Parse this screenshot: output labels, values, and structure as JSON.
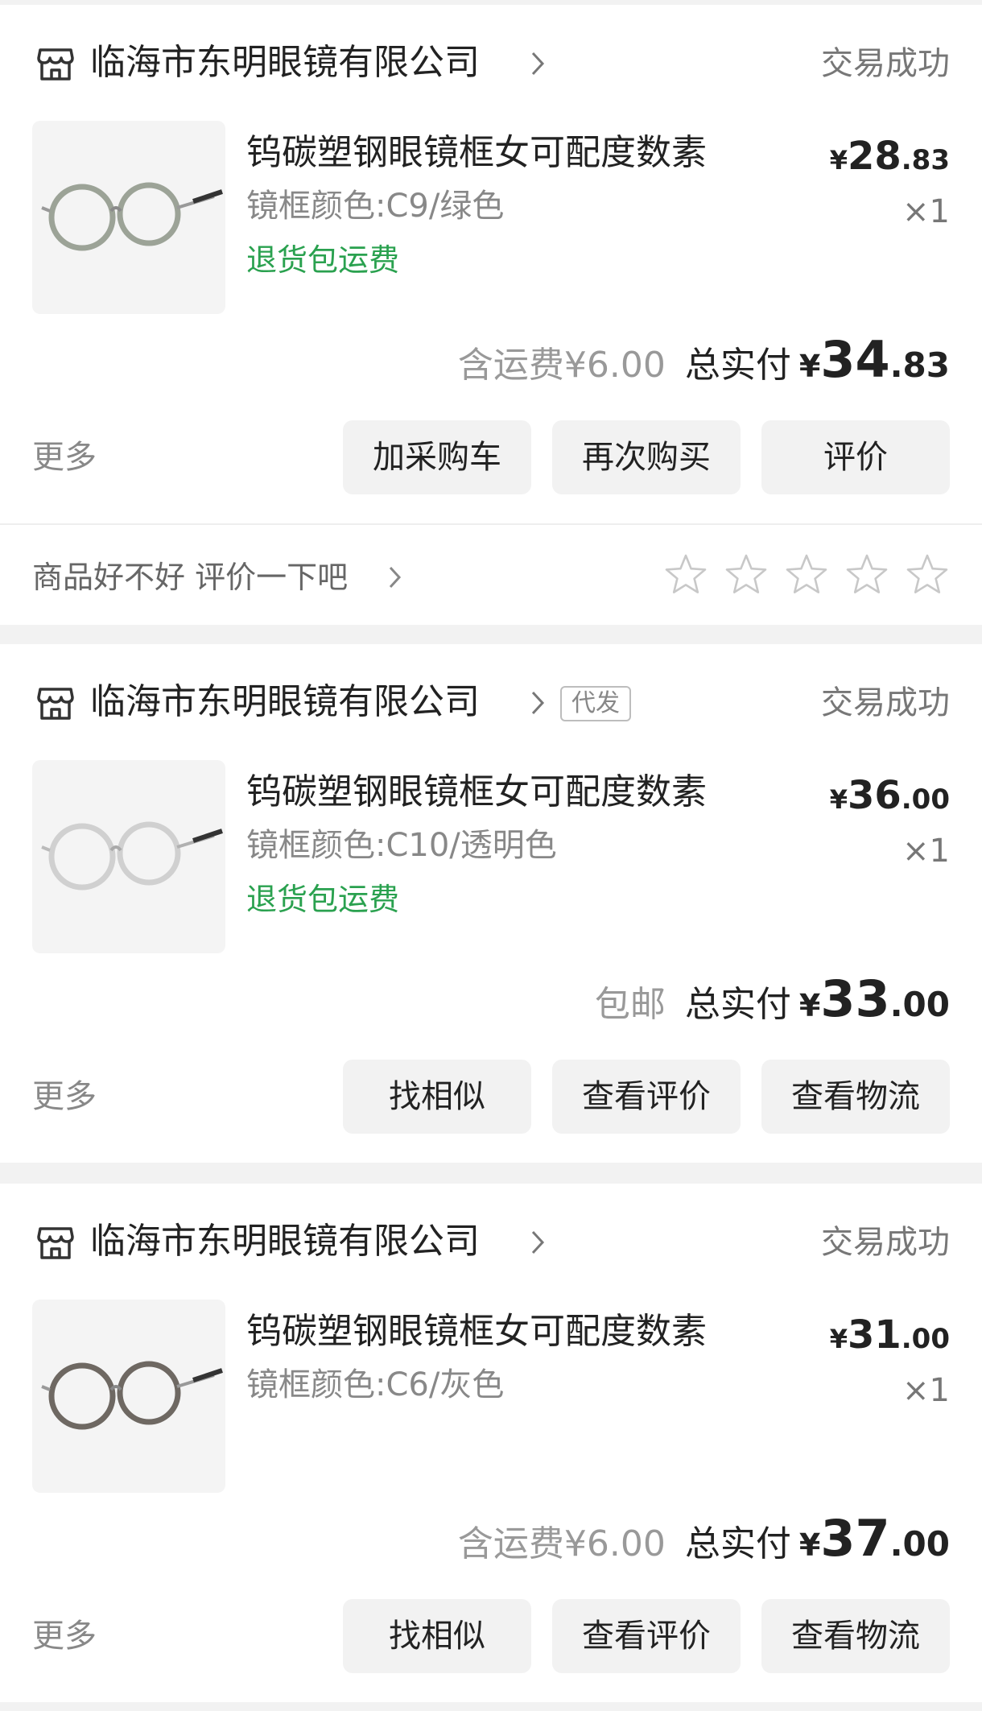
{
  "orders": [
    {
      "shop_name": "临海市东明眼镜有限公司",
      "tag": "",
      "status": "交易成功",
      "product_title": "钨碳塑钢眼镜框女可配度数素",
      "spec": "镜框颜色:C9/绿色",
      "return_note": "退货包运费",
      "unit_price": {
        "yen": "¥",
        "int": "28",
        "dec": ".83"
      },
      "qty": "×1",
      "shipping": "含运费¥6.00",
      "paid_label": "总实付",
      "total": {
        "yen": "¥",
        "int": "34",
        "dec": ".83"
      },
      "more": "更多",
      "buttons": [
        "加采购车",
        "再次购买",
        "评价"
      ],
      "review_prompt": "商品好不好 评价一下吧",
      "frame_color": "#8c9486"
    },
    {
      "shop_name": "临海市东明眼镜有限公司",
      "tag": "代发",
      "status": "交易成功",
      "product_title": "钨碳塑钢眼镜框女可配度数素",
      "spec": "镜框颜色:C10/透明色",
      "return_note": "退货包运费",
      "unit_price": {
        "yen": "¥",
        "int": "36",
        "dec": ".00"
      },
      "qty": "×1",
      "shipping": "包邮",
      "paid_label": "总实付",
      "total": {
        "yen": "¥",
        "int": "33",
        "dec": ".00"
      },
      "more": "更多",
      "buttons": [
        "找相似",
        "查看评价",
        "查看物流"
      ],
      "frame_color": "#d6d6d6"
    },
    {
      "shop_name": "临海市东明眼镜有限公司",
      "tag": "",
      "status": "交易成功",
      "product_title": "钨碳塑钢眼镜框女可配度数素",
      "spec": "镜框颜色:C6/灰色",
      "return_note": "",
      "unit_price": {
        "yen": "¥",
        "int": "31",
        "dec": ".00"
      },
      "qty": "×1",
      "shipping": "含运费¥6.00",
      "paid_label": "总实付",
      "total": {
        "yen": "¥",
        "int": "37",
        "dec": ".00"
      },
      "more": "更多",
      "buttons": [
        "找相似",
        "查看评价",
        "查看物流"
      ],
      "frame_color": "#6e6862"
    }
  ],
  "colors": {
    "accent_green": "#2aa14f",
    "background": "#f2f2f2",
    "button_bg": "#f2f2f2"
  }
}
